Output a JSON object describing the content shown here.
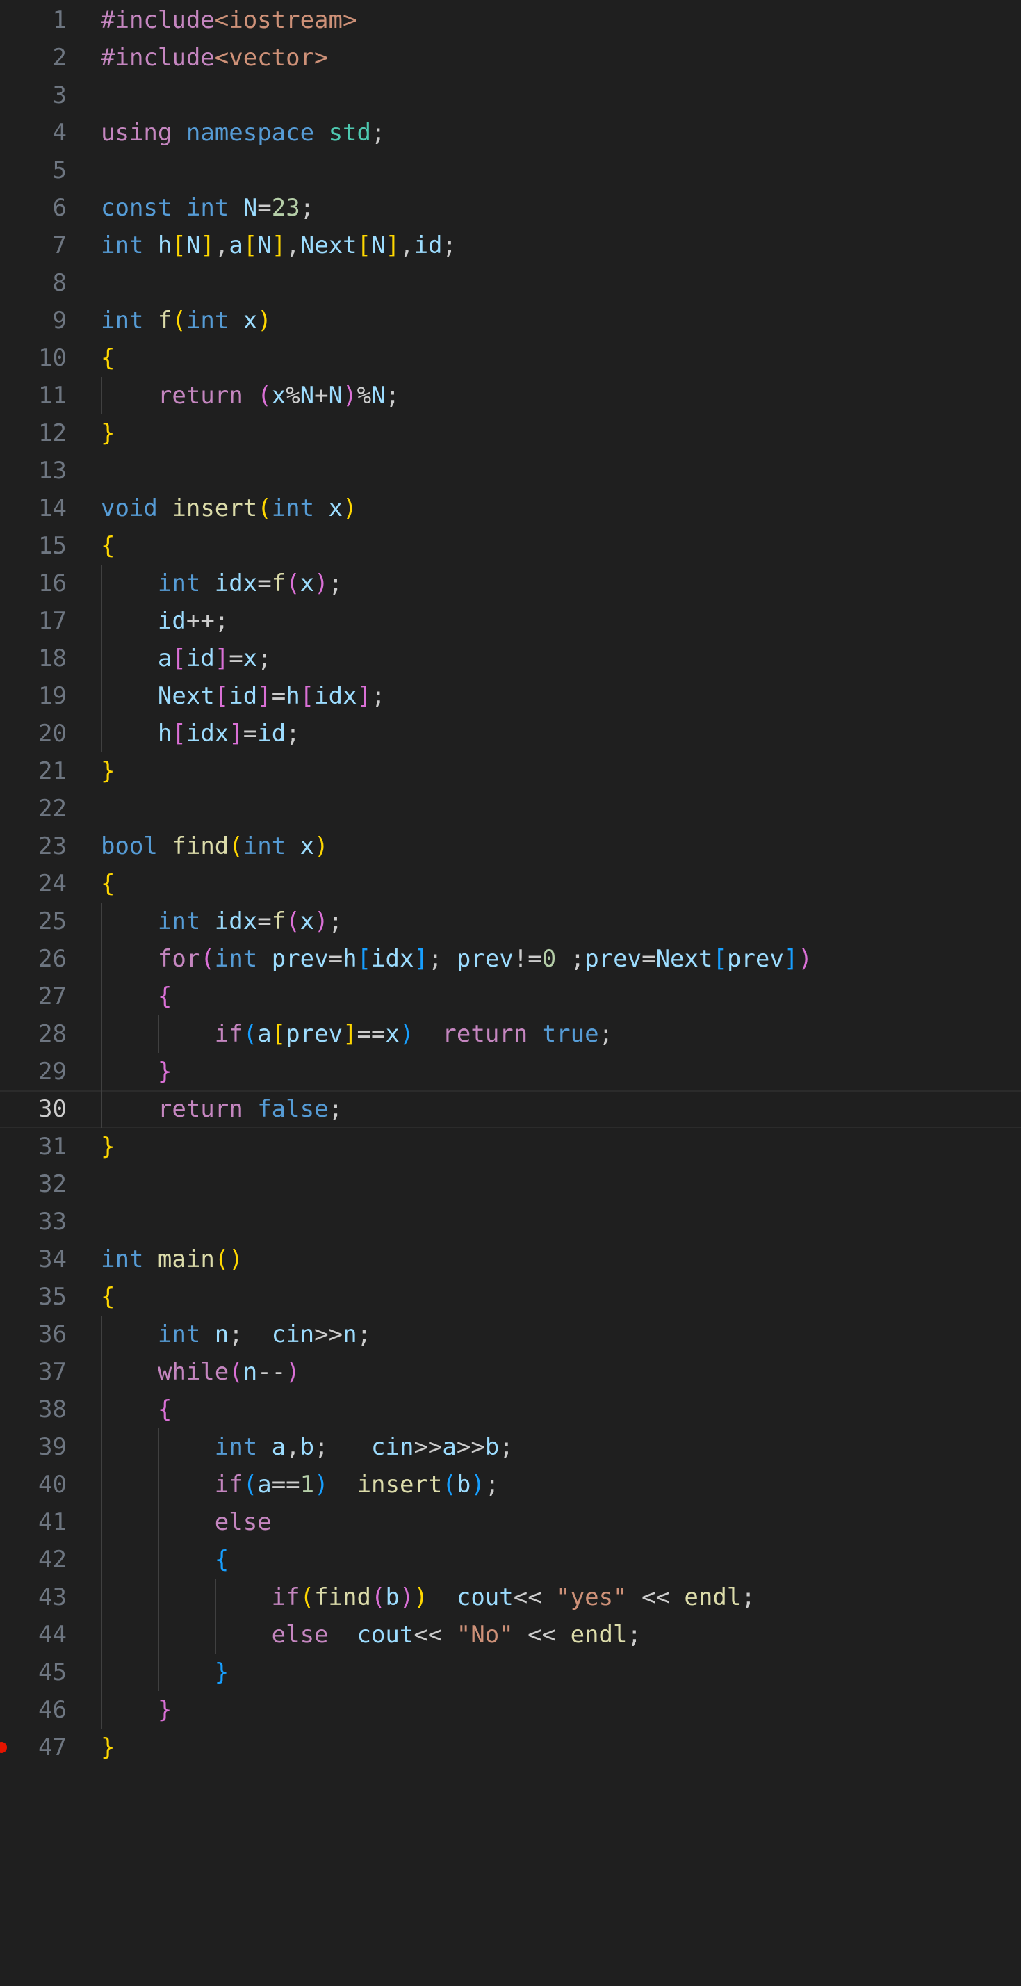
{
  "editor": {
    "language": "cpp",
    "current_line": 30,
    "breakpoint_line": 47,
    "colors": {
      "background": "#1f1f1f",
      "line_number": "#6e7681",
      "line_number_active": "#cccccc",
      "keyword": "#569cd6",
      "control": "#c586c0",
      "function": "#dcdcaa",
      "variable": "#9cdcfe",
      "namespace": "#4ec9b0",
      "number": "#b5cea8",
      "string": "#ce9178",
      "bracket_level_1": "#ffd700",
      "bracket_level_2": "#da70d6",
      "bracket_level_3": "#179fff",
      "breakpoint": "#e51400"
    },
    "lines": [
      {
        "n": "1",
        "tokens": [
          [
            "pp",
            "#include"
          ],
          [
            "inc",
            "<iostream>"
          ]
        ]
      },
      {
        "n": "2",
        "tokens": [
          [
            "pp",
            "#include"
          ],
          [
            "inc",
            "<vector>"
          ]
        ]
      },
      {
        "n": "3",
        "tokens": []
      },
      {
        "n": "4",
        "tokens": [
          [
            "ctl",
            "using"
          ],
          [
            "txt",
            " "
          ],
          [
            "kw",
            "namespace"
          ],
          [
            "txt",
            " "
          ],
          [
            "ns",
            "std"
          ],
          [
            "txt",
            ";"
          ]
        ]
      },
      {
        "n": "5",
        "tokens": []
      },
      {
        "n": "6",
        "tokens": [
          [
            "kw",
            "const"
          ],
          [
            "txt",
            " "
          ],
          [
            "kw",
            "int"
          ],
          [
            "txt",
            " "
          ],
          [
            "var",
            "N"
          ],
          [
            "txt",
            "="
          ],
          [
            "num",
            "23"
          ],
          [
            "txt",
            ";"
          ]
        ]
      },
      {
        "n": "7",
        "tokens": [
          [
            "kw",
            "int"
          ],
          [
            "txt",
            " "
          ],
          [
            "var",
            "h"
          ],
          [
            "b1",
            "["
          ],
          [
            "var",
            "N"
          ],
          [
            "b1",
            "]"
          ],
          [
            "txt",
            ","
          ],
          [
            "var",
            "a"
          ],
          [
            "b1",
            "["
          ],
          [
            "var",
            "N"
          ],
          [
            "b1",
            "]"
          ],
          [
            "txt",
            ","
          ],
          [
            "var",
            "Next"
          ],
          [
            "b1",
            "["
          ],
          [
            "var",
            "N"
          ],
          [
            "b1",
            "]"
          ],
          [
            "txt",
            ","
          ],
          [
            "var",
            "id"
          ],
          [
            "txt",
            ";"
          ]
        ]
      },
      {
        "n": "8",
        "tokens": []
      },
      {
        "n": "9",
        "tokens": [
          [
            "kw",
            "int"
          ],
          [
            "txt",
            " "
          ],
          [
            "fn",
            "f"
          ],
          [
            "b1",
            "("
          ],
          [
            "kw",
            "int"
          ],
          [
            "txt",
            " "
          ],
          [
            "var",
            "x"
          ],
          [
            "b1",
            ")"
          ]
        ]
      },
      {
        "n": "10",
        "tokens": [
          [
            "b1",
            "{"
          ]
        ]
      },
      {
        "n": "11",
        "tokens": [
          [
            "txt",
            "    "
          ],
          [
            "ctl",
            "return"
          ],
          [
            "txt",
            " "
          ],
          [
            "b2",
            "("
          ],
          [
            "var",
            "x"
          ],
          [
            "txt",
            "%"
          ],
          [
            "var",
            "N"
          ],
          [
            "txt",
            "+"
          ],
          [
            "var",
            "N"
          ],
          [
            "b2",
            ")"
          ],
          [
            "txt",
            "%"
          ],
          [
            "var",
            "N"
          ],
          [
            "txt",
            ";"
          ]
        ]
      },
      {
        "n": "12",
        "tokens": [
          [
            "b1",
            "}"
          ]
        ]
      },
      {
        "n": "13",
        "tokens": []
      },
      {
        "n": "14",
        "tokens": [
          [
            "kw",
            "void"
          ],
          [
            "txt",
            " "
          ],
          [
            "fn",
            "insert"
          ],
          [
            "b1",
            "("
          ],
          [
            "kw",
            "int"
          ],
          [
            "txt",
            " "
          ],
          [
            "var",
            "x"
          ],
          [
            "b1",
            ")"
          ]
        ]
      },
      {
        "n": "15",
        "tokens": [
          [
            "b1",
            "{"
          ]
        ]
      },
      {
        "n": "16",
        "tokens": [
          [
            "txt",
            "    "
          ],
          [
            "kw",
            "int"
          ],
          [
            "txt",
            " "
          ],
          [
            "var",
            "idx"
          ],
          [
            "txt",
            "="
          ],
          [
            "fn",
            "f"
          ],
          [
            "b2",
            "("
          ],
          [
            "var",
            "x"
          ],
          [
            "b2",
            ")"
          ],
          [
            "txt",
            ";"
          ]
        ]
      },
      {
        "n": "17",
        "tokens": [
          [
            "txt",
            "    "
          ],
          [
            "var",
            "id"
          ],
          [
            "txt",
            "++;"
          ]
        ]
      },
      {
        "n": "18",
        "tokens": [
          [
            "txt",
            "    "
          ],
          [
            "var",
            "a"
          ],
          [
            "b2",
            "["
          ],
          [
            "var",
            "id"
          ],
          [
            "b2",
            "]"
          ],
          [
            "txt",
            "="
          ],
          [
            "var",
            "x"
          ],
          [
            "txt",
            ";"
          ]
        ]
      },
      {
        "n": "19",
        "tokens": [
          [
            "txt",
            "    "
          ],
          [
            "var",
            "Next"
          ],
          [
            "b2",
            "["
          ],
          [
            "var",
            "id"
          ],
          [
            "b2",
            "]"
          ],
          [
            "txt",
            "="
          ],
          [
            "var",
            "h"
          ],
          [
            "b2",
            "["
          ],
          [
            "var",
            "idx"
          ],
          [
            "b2",
            "]"
          ],
          [
            "txt",
            ";"
          ]
        ]
      },
      {
        "n": "20",
        "tokens": [
          [
            "txt",
            "    "
          ],
          [
            "var",
            "h"
          ],
          [
            "b2",
            "["
          ],
          [
            "var",
            "idx"
          ],
          [
            "b2",
            "]"
          ],
          [
            "txt",
            "="
          ],
          [
            "var",
            "id"
          ],
          [
            "txt",
            ";"
          ]
        ]
      },
      {
        "n": "21",
        "tokens": [
          [
            "b1",
            "}"
          ]
        ]
      },
      {
        "n": "22",
        "tokens": []
      },
      {
        "n": "23",
        "tokens": [
          [
            "kw",
            "bool"
          ],
          [
            "txt",
            " "
          ],
          [
            "fn",
            "find"
          ],
          [
            "b1",
            "("
          ],
          [
            "kw",
            "int"
          ],
          [
            "txt",
            " "
          ],
          [
            "var",
            "x"
          ],
          [
            "b1",
            ")"
          ]
        ]
      },
      {
        "n": "24",
        "tokens": [
          [
            "b1",
            "{"
          ]
        ]
      },
      {
        "n": "25",
        "tokens": [
          [
            "txt",
            "    "
          ],
          [
            "kw",
            "int"
          ],
          [
            "txt",
            " "
          ],
          [
            "var",
            "idx"
          ],
          [
            "txt",
            "="
          ],
          [
            "fn",
            "f"
          ],
          [
            "b2",
            "("
          ],
          [
            "var",
            "x"
          ],
          [
            "b2",
            ")"
          ],
          [
            "txt",
            ";"
          ]
        ]
      },
      {
        "n": "26",
        "tokens": [
          [
            "txt",
            "    "
          ],
          [
            "ctl",
            "for"
          ],
          [
            "b2",
            "("
          ],
          [
            "kw",
            "int"
          ],
          [
            "txt",
            " "
          ],
          [
            "var",
            "prev"
          ],
          [
            "txt",
            "="
          ],
          [
            "var",
            "h"
          ],
          [
            "b3",
            "["
          ],
          [
            "var",
            "idx"
          ],
          [
            "b3",
            "]"
          ],
          [
            "txt",
            "; "
          ],
          [
            "var",
            "prev"
          ],
          [
            "txt",
            "!="
          ],
          [
            "num",
            "0"
          ],
          [
            "txt",
            " ;"
          ],
          [
            "var",
            "prev"
          ],
          [
            "txt",
            "="
          ],
          [
            "var",
            "Next"
          ],
          [
            "b3",
            "["
          ],
          [
            "var",
            "prev"
          ],
          [
            "b3",
            "]"
          ],
          [
            "b2",
            ")"
          ]
        ]
      },
      {
        "n": "27",
        "tokens": [
          [
            "txt",
            "    "
          ],
          [
            "b2",
            "{"
          ]
        ]
      },
      {
        "n": "28",
        "tokens": [
          [
            "txt",
            "        "
          ],
          [
            "ctl",
            "if"
          ],
          [
            "b3",
            "("
          ],
          [
            "var",
            "a"
          ],
          [
            "b1",
            "["
          ],
          [
            "var",
            "prev"
          ],
          [
            "b1",
            "]"
          ],
          [
            "txt",
            "=="
          ],
          [
            "var",
            "x"
          ],
          [
            "b3",
            ")"
          ],
          [
            "txt",
            "  "
          ],
          [
            "ctl",
            "return"
          ],
          [
            "txt",
            " "
          ],
          [
            "kw",
            "true"
          ],
          [
            "txt",
            ";"
          ]
        ]
      },
      {
        "n": "29",
        "tokens": [
          [
            "txt",
            "    "
          ],
          [
            "b2",
            "}"
          ]
        ]
      },
      {
        "n": "30",
        "tokens": [
          [
            "txt",
            "    "
          ],
          [
            "ctl",
            "return"
          ],
          [
            "txt",
            " "
          ],
          [
            "kw",
            "false"
          ],
          [
            "txt",
            ";"
          ]
        ]
      },
      {
        "n": "31",
        "tokens": [
          [
            "b1",
            "}"
          ]
        ]
      },
      {
        "n": "32",
        "tokens": []
      },
      {
        "n": "33",
        "tokens": []
      },
      {
        "n": "34",
        "tokens": [
          [
            "kw",
            "int"
          ],
          [
            "txt",
            " "
          ],
          [
            "fn",
            "main"
          ],
          [
            "b1",
            "()"
          ]
        ]
      },
      {
        "n": "35",
        "tokens": [
          [
            "b1",
            "{"
          ]
        ]
      },
      {
        "n": "36",
        "tokens": [
          [
            "txt",
            "    "
          ],
          [
            "kw",
            "int"
          ],
          [
            "txt",
            " "
          ],
          [
            "var",
            "n"
          ],
          [
            "txt",
            ";  "
          ],
          [
            "var",
            "cin"
          ],
          [
            "txt",
            ">>"
          ],
          [
            "var",
            "n"
          ],
          [
            "txt",
            ";"
          ]
        ]
      },
      {
        "n": "37",
        "tokens": [
          [
            "txt",
            "    "
          ],
          [
            "ctl",
            "while"
          ],
          [
            "b2",
            "("
          ],
          [
            "var",
            "n"
          ],
          [
            "txt",
            "--"
          ],
          [
            "b2",
            ")"
          ]
        ]
      },
      {
        "n": "38",
        "tokens": [
          [
            "txt",
            "    "
          ],
          [
            "b2",
            "{"
          ]
        ]
      },
      {
        "n": "39",
        "tokens": [
          [
            "txt",
            "        "
          ],
          [
            "kw",
            "int"
          ],
          [
            "txt",
            " "
          ],
          [
            "var",
            "a"
          ],
          [
            "txt",
            ","
          ],
          [
            "var",
            "b"
          ],
          [
            "txt",
            ";   "
          ],
          [
            "var",
            "cin"
          ],
          [
            "txt",
            ">>"
          ],
          [
            "var",
            "a"
          ],
          [
            "txt",
            ">>"
          ],
          [
            "var",
            "b"
          ],
          [
            "txt",
            ";"
          ]
        ]
      },
      {
        "n": "40",
        "tokens": [
          [
            "txt",
            "        "
          ],
          [
            "ctl",
            "if"
          ],
          [
            "b3",
            "("
          ],
          [
            "var",
            "a"
          ],
          [
            "txt",
            "=="
          ],
          [
            "num",
            "1"
          ],
          [
            "b3",
            ")"
          ],
          [
            "txt",
            "  "
          ],
          [
            "fn",
            "insert"
          ],
          [
            "b3",
            "("
          ],
          [
            "var",
            "b"
          ],
          [
            "b3",
            ")"
          ],
          [
            "txt",
            ";"
          ]
        ]
      },
      {
        "n": "41",
        "tokens": [
          [
            "txt",
            "        "
          ],
          [
            "ctl",
            "else"
          ]
        ]
      },
      {
        "n": "42",
        "tokens": [
          [
            "txt",
            "        "
          ],
          [
            "b3",
            "{"
          ]
        ]
      },
      {
        "n": "43",
        "tokens": [
          [
            "txt",
            "            "
          ],
          [
            "ctl",
            "if"
          ],
          [
            "b1",
            "("
          ],
          [
            "fn",
            "find"
          ],
          [
            "b2",
            "("
          ],
          [
            "var",
            "b"
          ],
          [
            "b2",
            ")"
          ],
          [
            "b1",
            ")"
          ],
          [
            "txt",
            "  "
          ],
          [
            "var",
            "cout"
          ],
          [
            "txt",
            "<< "
          ],
          [
            "str",
            "\"yes\""
          ],
          [
            "txt",
            " << "
          ],
          [
            "fn",
            "endl"
          ],
          [
            "txt",
            ";"
          ]
        ]
      },
      {
        "n": "44",
        "tokens": [
          [
            "txt",
            "            "
          ],
          [
            "ctl",
            "else"
          ],
          [
            "txt",
            "  "
          ],
          [
            "var",
            "cout"
          ],
          [
            "txt",
            "<< "
          ],
          [
            "str",
            "\"No\""
          ],
          [
            "txt",
            " << "
          ],
          [
            "fn",
            "endl"
          ],
          [
            "txt",
            ";"
          ]
        ]
      },
      {
        "n": "45",
        "tokens": [
          [
            "txt",
            "        "
          ],
          [
            "b3",
            "}"
          ]
        ]
      },
      {
        "n": "46",
        "tokens": [
          [
            "txt",
            "    "
          ],
          [
            "b2",
            "}"
          ]
        ]
      },
      {
        "n": "47",
        "tokens": [
          [
            "b1",
            "}"
          ]
        ]
      }
    ]
  }
}
